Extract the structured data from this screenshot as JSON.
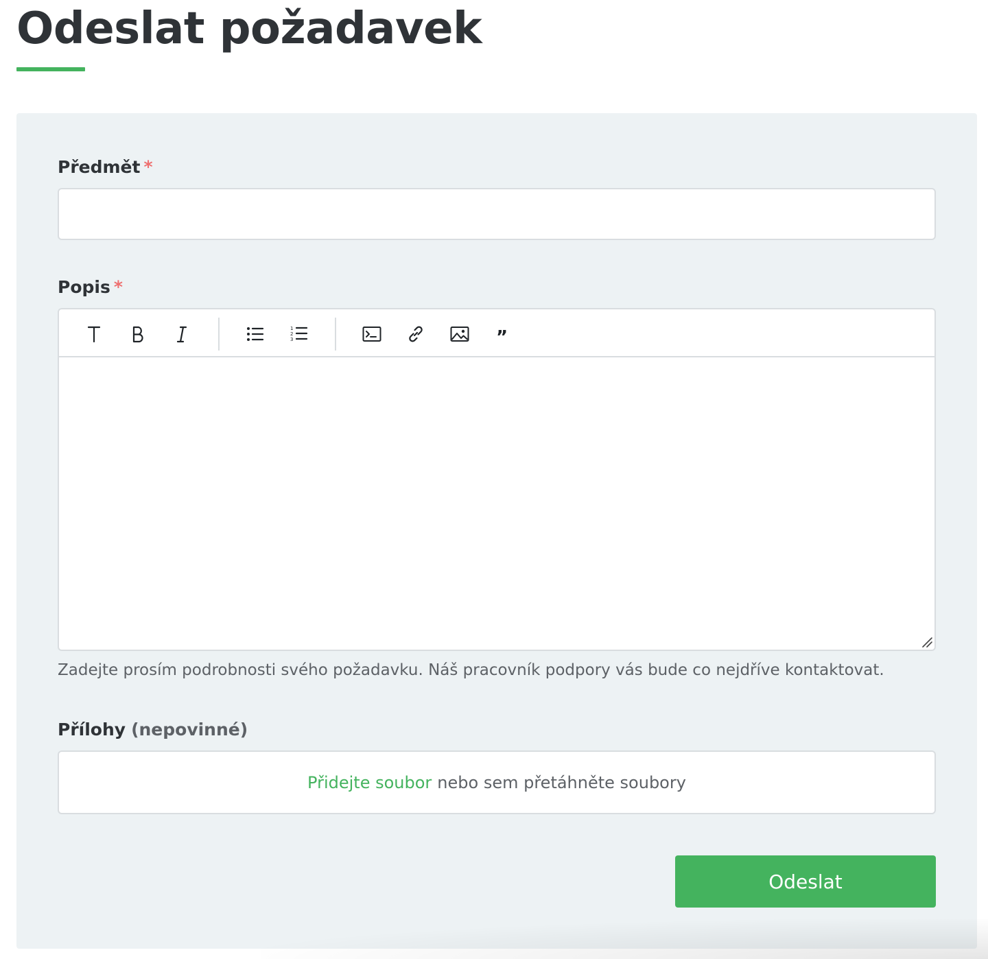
{
  "page": {
    "title": "Odeslat požadavek"
  },
  "form": {
    "subject": {
      "label": "Předmět",
      "required_mark": "*",
      "value": ""
    },
    "description": {
      "label": "Popis",
      "required_mark": "*",
      "help_text": "Zadejte prosím podrobnosti svého požadavku. Náš pracovník podpory vás bude co nejdříve kontaktovat.",
      "toolbar": [
        {
          "name": "heading",
          "icon": "text-heading-icon"
        },
        {
          "name": "bold",
          "icon": "bold-icon"
        },
        {
          "name": "italic",
          "icon": "italic-icon"
        },
        {
          "name": "bullet-list",
          "icon": "bullet-list-icon"
        },
        {
          "name": "numbered-list",
          "icon": "numbered-list-icon"
        },
        {
          "name": "code",
          "icon": "code-block-icon"
        },
        {
          "name": "link",
          "icon": "link-icon"
        },
        {
          "name": "image",
          "icon": "image-icon"
        },
        {
          "name": "quote",
          "icon": "quote-icon"
        }
      ]
    },
    "attachments": {
      "label": "Přílohy",
      "optional_text": "(nepovinné)",
      "add_link": "Přidejte soubor",
      "drop_text": "nebo sem přetáhněte soubory"
    },
    "submit_label": "Odeslat"
  },
  "colors": {
    "accent": "#44b35e",
    "required": "#ee6f6f",
    "panel_bg": "#edf2f4",
    "text": "#2f3337",
    "muted": "#5d6166"
  }
}
